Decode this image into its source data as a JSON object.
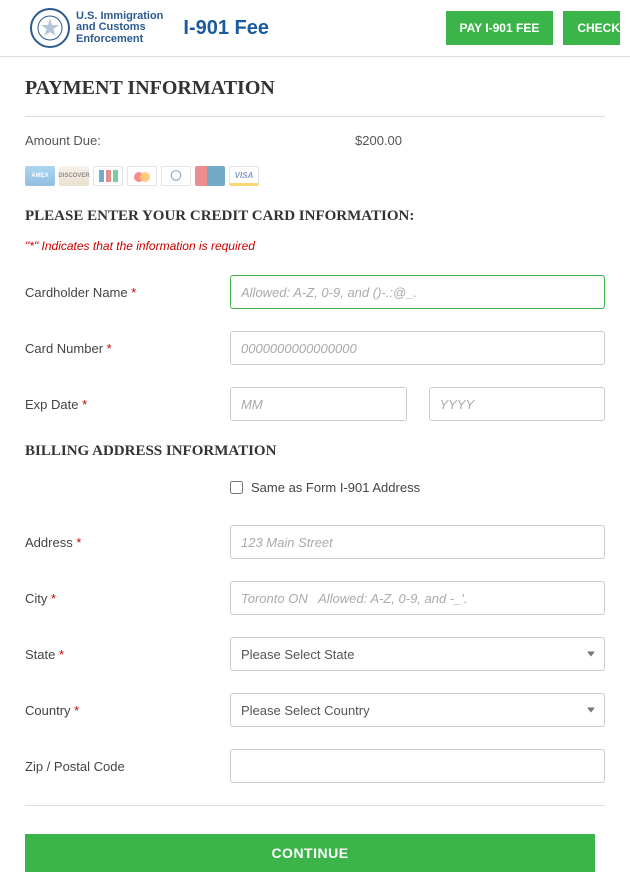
{
  "header": {
    "brand_line1": "U.S. Immigration",
    "brand_line2": "and Customs",
    "brand_line3": "Enforcement",
    "page_title": "I-901 Fee",
    "nav": {
      "pay_label": "PAY I-901 FEE",
      "check_label": "CHECK"
    }
  },
  "section1": {
    "title": "PAYMENT INFORMATION",
    "amount_label": "Amount Due:",
    "amount_value": "$200.00"
  },
  "cc": {
    "heading": "PLEASE ENTER YOUR CREDIT CARD INFORMATION:",
    "required_note_prefix": "\"",
    "required_note_ast": "*",
    "required_note_suffix": "\" Indicates that the information is required",
    "labels": {
      "cardholder": "Cardholder Name",
      "cardnumber": "Card Number",
      "expdate": "Exp Date"
    },
    "placeholders": {
      "cardholder": "Allowed: A-Z, 0-9, and ()-.:@_.",
      "cardnumber": "0000000000000000",
      "exp_mm": "MM",
      "exp_yyyy": "YYYY"
    }
  },
  "billing": {
    "heading": "BILLING ADDRESS INFORMATION",
    "same_as_label": "Same as Form I-901 Address",
    "labels": {
      "address": "Address",
      "city": "City",
      "state": "State",
      "country": "Country",
      "zip": "Zip / Postal Code"
    },
    "placeholders": {
      "address": "123 Main Street",
      "city": "Toronto ON   Allowed: A-Z, 0-9, and -_'.",
      "state": "Please Select State",
      "country": "Please Select Country"
    }
  },
  "continue_label": "CONTINUE",
  "ast": " *"
}
